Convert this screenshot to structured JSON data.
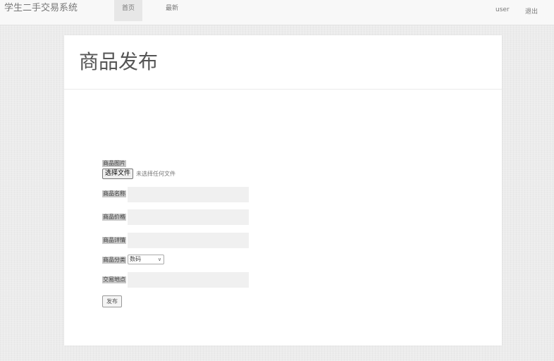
{
  "navbar": {
    "brand": "学生二手交易系统",
    "links": [
      {
        "label": "首页",
        "active": true
      },
      {
        "label": "最新",
        "active": false
      }
    ],
    "user": "user",
    "logout": "退出"
  },
  "page": {
    "title": "商品发布"
  },
  "form": {
    "image_label": "商品图片",
    "file_button": "选择文件",
    "file_status": "未选择任何文件",
    "name_label": "商品名称",
    "name_value": "",
    "price_label": "商品价格",
    "price_value": "",
    "detail_label": "商品详情",
    "detail_value": "",
    "category_label": "商品分类",
    "category_selected": "数码",
    "location_label": "交易地点",
    "location_value": "",
    "submit_label": "发布"
  },
  "colors": {
    "navbar_bg": "#f8f8f8",
    "active_tab_bg": "#e7e7e7",
    "field_bg": "#f0f0f0",
    "label_highlight": "#c8c8c8"
  }
}
